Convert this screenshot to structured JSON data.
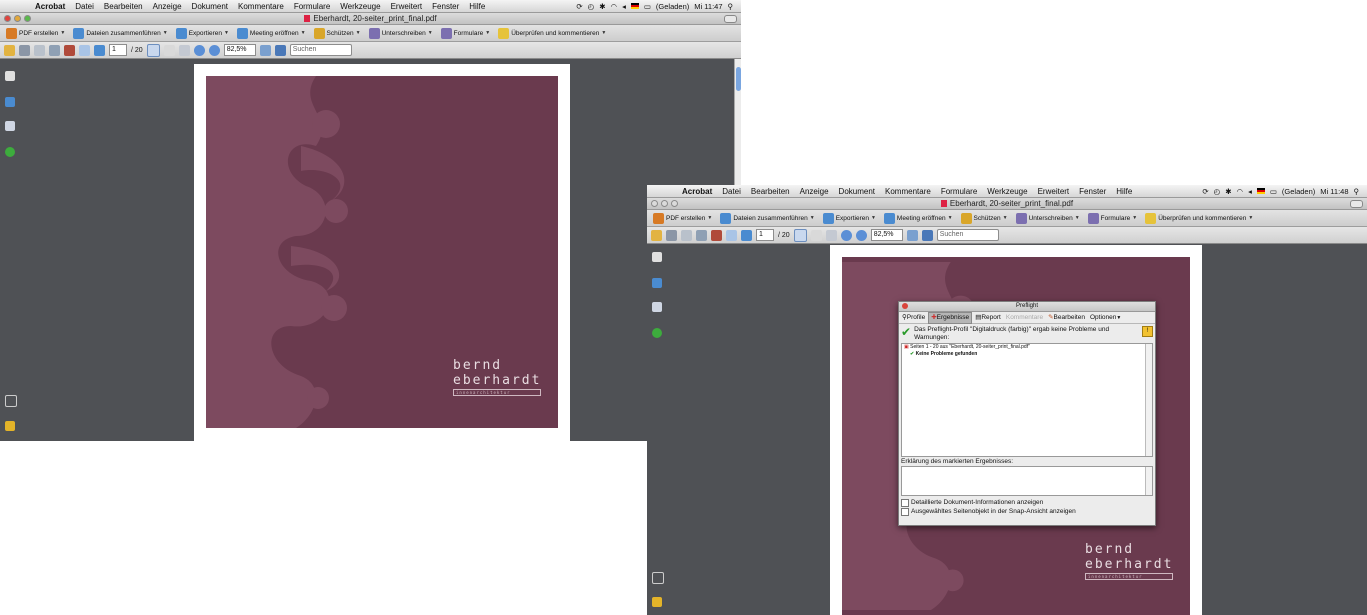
{
  "left": {
    "menu": [
      "Acrobat",
      "Datei",
      "Bearbeiten",
      "Anzeige",
      "Dokument",
      "Kommentare",
      "Formulare",
      "Werkzeuge",
      "Erweitert",
      "Fenster",
      "Hilfe"
    ],
    "status_right": "(Geladen)",
    "clock": "Mi 11:47",
    "window_title": "Eberhardt, 20-seiter_print_final.pdf",
    "toolbar": [
      "PDF erstellen",
      "Dateien zusammenführen",
      "Exportieren",
      "Meeting eröffnen",
      "Schützen",
      "Unterschreiben",
      "Formulare",
      "Überprüfen und kommentieren"
    ],
    "page_current": "1",
    "page_total": "/ 20",
    "zoom": "82,5%",
    "search_placeholder": "Suchen"
  },
  "right": {
    "menu": [
      "Acrobat",
      "Datei",
      "Bearbeiten",
      "Anzeige",
      "Dokument",
      "Kommentare",
      "Formulare",
      "Werkzeuge",
      "Erweitert",
      "Fenster",
      "Hilfe"
    ],
    "status_right": "(Geladen)",
    "clock": "Mi 11:48",
    "window_title": "Eberhardt, 20-seiter_print_final.pdf",
    "toolbar": [
      "PDF erstellen",
      "Dateien zusammenführen",
      "Exportieren",
      "Meeting eröffnen",
      "Schützen",
      "Unterschreiben",
      "Formulare",
      "Überprüfen und kommentieren"
    ],
    "page_current": "1",
    "page_total": "/ 20",
    "zoom": "82,5%",
    "search_placeholder": "Suchen"
  },
  "logo": {
    "line1": "bernd",
    "line2": "eberhardt",
    "line3": "innenarchitektur"
  },
  "preflight": {
    "title": "Preflight",
    "tabs": [
      "Profile",
      "Ergebnisse",
      "Report",
      "Kommentare",
      "Bearbeiten",
      "Optionen"
    ],
    "message": "Das Preflight-Profil \"Digitaldruck (farbig)\" ergab keine Probleme und Warnungen:",
    "result_row": "Seiten 1 - 20 aus \"Eberhardt, 20-seiter_print_final.pdf\"",
    "result_sub": "Keine Probleme gefunden",
    "explanation_label": "Erklärung des markierten Ergebnisses:",
    "checkbox1": "Detaillierte Dokument-Informationen anzeigen",
    "checkbox2": "Ausgewähltes Seitenobjekt in der Snap-Ansicht anzeigen"
  },
  "colors": {
    "cover": "#6a3a4e",
    "ornament": "#7d4a5f",
    "desk": "#4f5155",
    "accent": "#7aa6e0"
  }
}
